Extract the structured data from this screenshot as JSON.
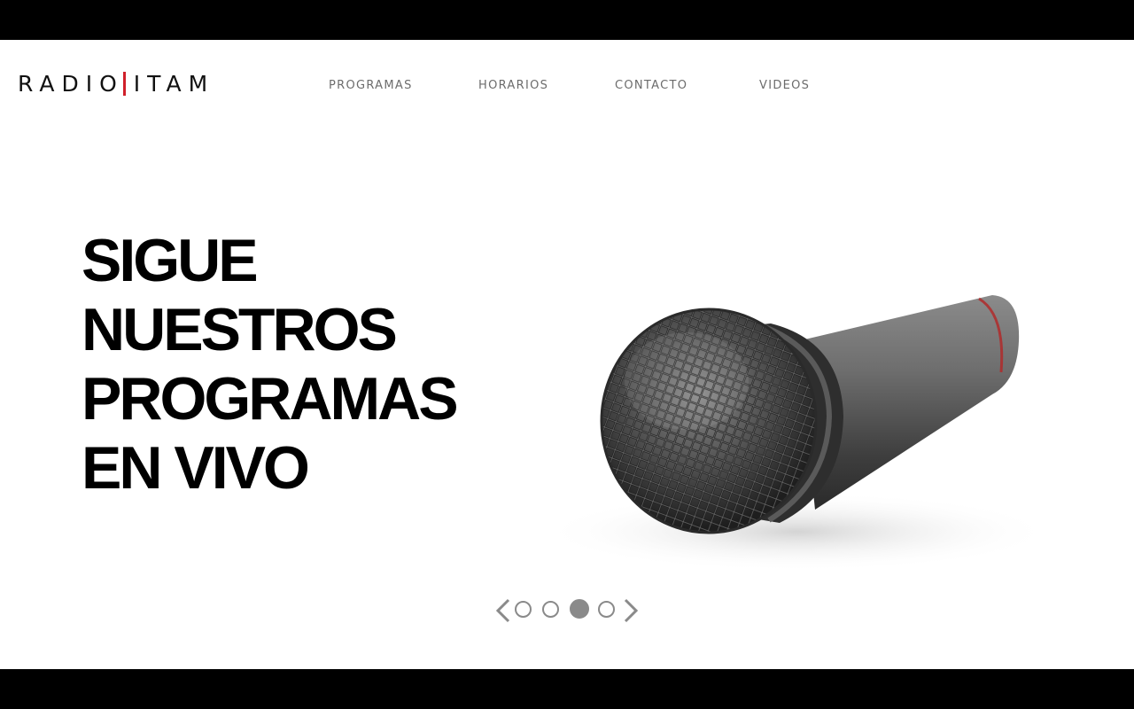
{
  "brand": {
    "left": "RADIO",
    "right": "ITAM",
    "accent_color": "#d0202a"
  },
  "nav": {
    "items": [
      {
        "label": "PROGRAMAS"
      },
      {
        "label": "HORARIOS"
      },
      {
        "label": "CONTACTO"
      },
      {
        "label": "VIDEOS"
      }
    ]
  },
  "hero": {
    "lines": [
      "SIGUE",
      "NUESTROS",
      "PROGRAMAS",
      "EN VIVO"
    ],
    "image_icon": "microphone-image"
  },
  "carousel": {
    "prev_icon": "chevron-left-icon",
    "next_icon": "chevron-right-icon",
    "slide_count": 4,
    "active_slide": 3,
    "dot_color": "#8a8a8a"
  }
}
